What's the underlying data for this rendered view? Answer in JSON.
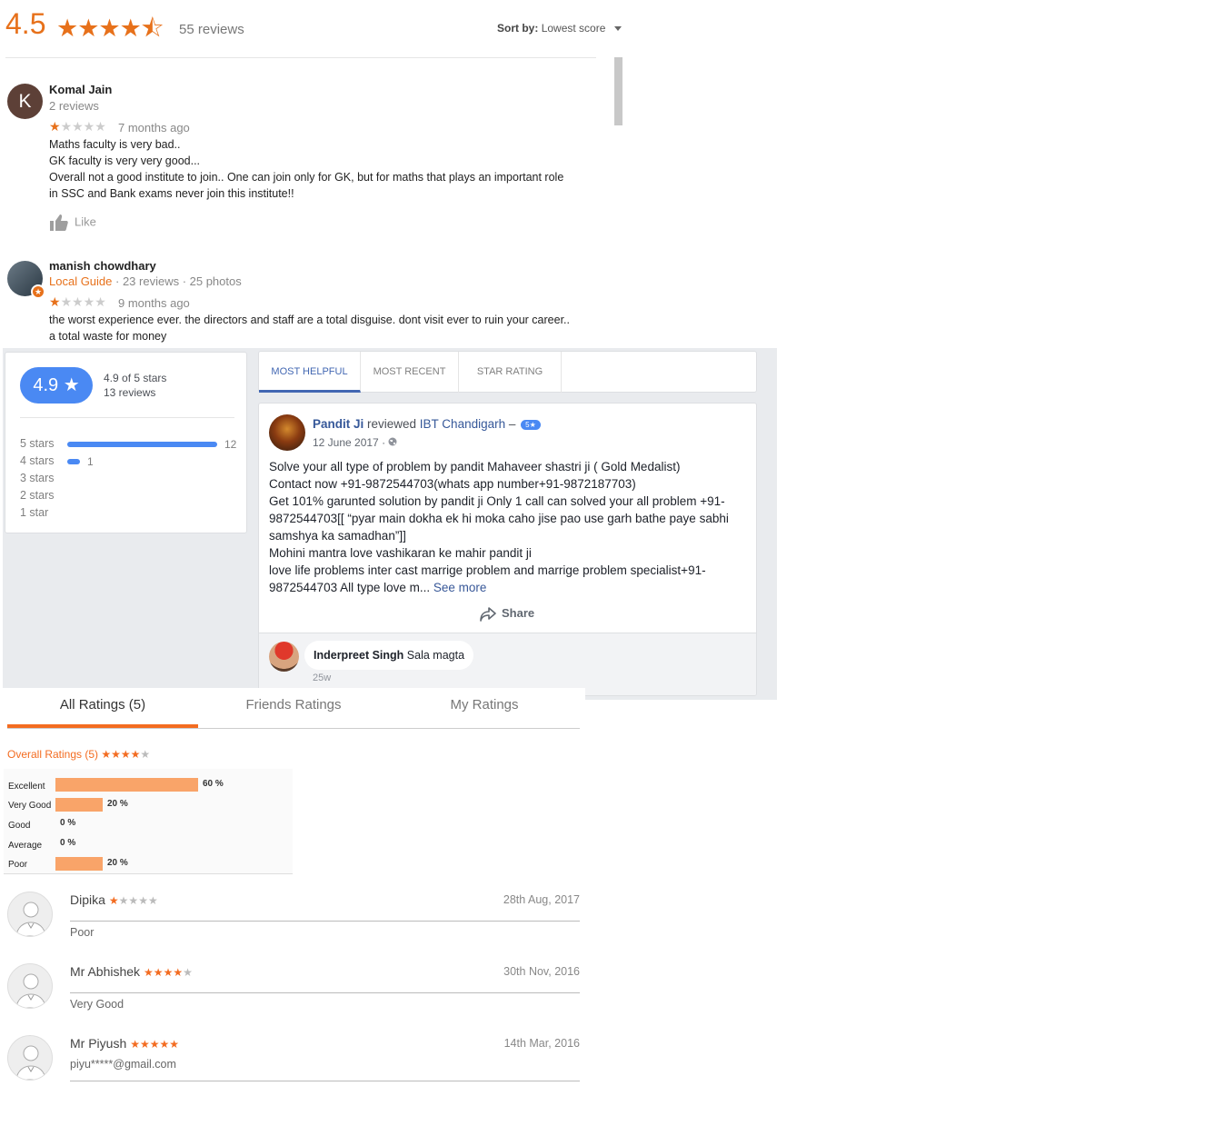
{
  "google": {
    "rating": "4.5",
    "stars": "★★★★⯪",
    "review_count": "55 reviews",
    "sort_label": "Sort by:",
    "sort_value": "Lowest score",
    "reviews": [
      {
        "avatar_letter": "K",
        "name": "Komal Jain",
        "meta": "2 reviews",
        "stars_on": "★",
        "stars_off": "★★★★",
        "when": "7 months ago",
        "lines": [
          "Maths faculty is very bad..",
          "GK faculty is very very good...",
          "Overall not a good institute to join.. One can join only for GK, but for maths that plays an important role",
          "in SSC and Bank exams never join this institute!!"
        ],
        "like": "Like"
      },
      {
        "name": "manish chowdhary",
        "local_guide": "Local Guide",
        "meta": " · 23 reviews · 25 photos",
        "stars_on": "★",
        "stars_off": "★★★★",
        "when": "9 months ago",
        "lines": [
          "the worst experience ever. the directors and staff are a total disguise. dont visit ever to ruin your career..",
          "a total waste for money"
        ]
      }
    ]
  },
  "facebook": {
    "summary": {
      "rating": "4.9 ★",
      "of_text": "4.9 of 5 stars",
      "count": "13 reviews",
      "rows": [
        {
          "label": "5 stars",
          "count": "12",
          "value": 12
        },
        {
          "label": "4 stars",
          "count": "1",
          "value": 1
        },
        {
          "label": "3 stars",
          "count": "",
          "value": 0
        },
        {
          "label": "2 stars",
          "count": "",
          "value": 0
        },
        {
          "label": "1 star",
          "count": "",
          "value": 0
        }
      ]
    },
    "tabs": [
      "MOST HELPFUL",
      "MOST RECENT",
      "STAR RATING"
    ],
    "post": {
      "author": "Pandit Ji",
      "verb": " reviewed ",
      "page": "IBT Chandigarh",
      "dash": " – ",
      "badge": "5★",
      "date": "12 June 2017 · ",
      "globe_icon": "globe-icon",
      "body_lines": [
        "Solve your all type of problem by pandit Mahaveer shastri ji ( Gold Medalist)",
        "Contact now +91-9872544703(whats app number+91-9872187703)",
        "Get 101% garunted solution by pandit ji Only 1 call can solved your all problem +91-",
        "9872544703[[ “pyar main dokha ek hi moka caho jise pao use garh bathe paye sabhi",
        "samshya ka samadhan”]]",
        "Mohini mantra love vashikaran ke mahir pandit ji",
        "love life problems inter cast marrige problem and marrige problem specialist+91-"
      ],
      "body_last": "9872544703 All type love m... ",
      "see_more": "See more",
      "share": "Share",
      "comment": {
        "name": "Inderpreet Singh",
        "text": " Sala magta",
        "ago": "25w"
      }
    }
  },
  "ratings": {
    "tabs": [
      "All Ratings (5)",
      "Friends Ratings",
      "My Ratings"
    ],
    "overall_label": "Overall Ratings (5)",
    "overall_stars_on": "★★★★",
    "overall_stars_off": "★",
    "bars": [
      {
        "label": "Excellent",
        "pct": "60 %",
        "value": 60
      },
      {
        "label": "Very Good",
        "pct": "20 %",
        "value": 20
      },
      {
        "label": "Good",
        "pct": "0 %",
        "value": 0
      },
      {
        "label": "Average",
        "pct": "0 %",
        "value": 0
      },
      {
        "label": "Poor",
        "pct": "20 %",
        "value": 20
      }
    ],
    "items": [
      {
        "name": "Dipika",
        "stars_on": "★",
        "stars_off": "★★★★",
        "date": "28th Aug, 2017",
        "text": "Poor"
      },
      {
        "name": "Mr Abhishek",
        "stars_on": "★★★★",
        "stars_off": "★",
        "date": "30th Nov, 2016",
        "text": "Very Good"
      },
      {
        "name": "Mr Piyush",
        "stars_on": "★★★★★",
        "stars_off": "",
        "date": "14th Mar, 2016",
        "text": "piyu*****@gmail.com"
      }
    ]
  },
  "colors": {
    "google_orange": "#e7711b",
    "fb_blue": "#4a89f3",
    "fb_link": "#365899",
    "ratings_orange": "#f36c21",
    "bar_fill": "#f9a469"
  }
}
